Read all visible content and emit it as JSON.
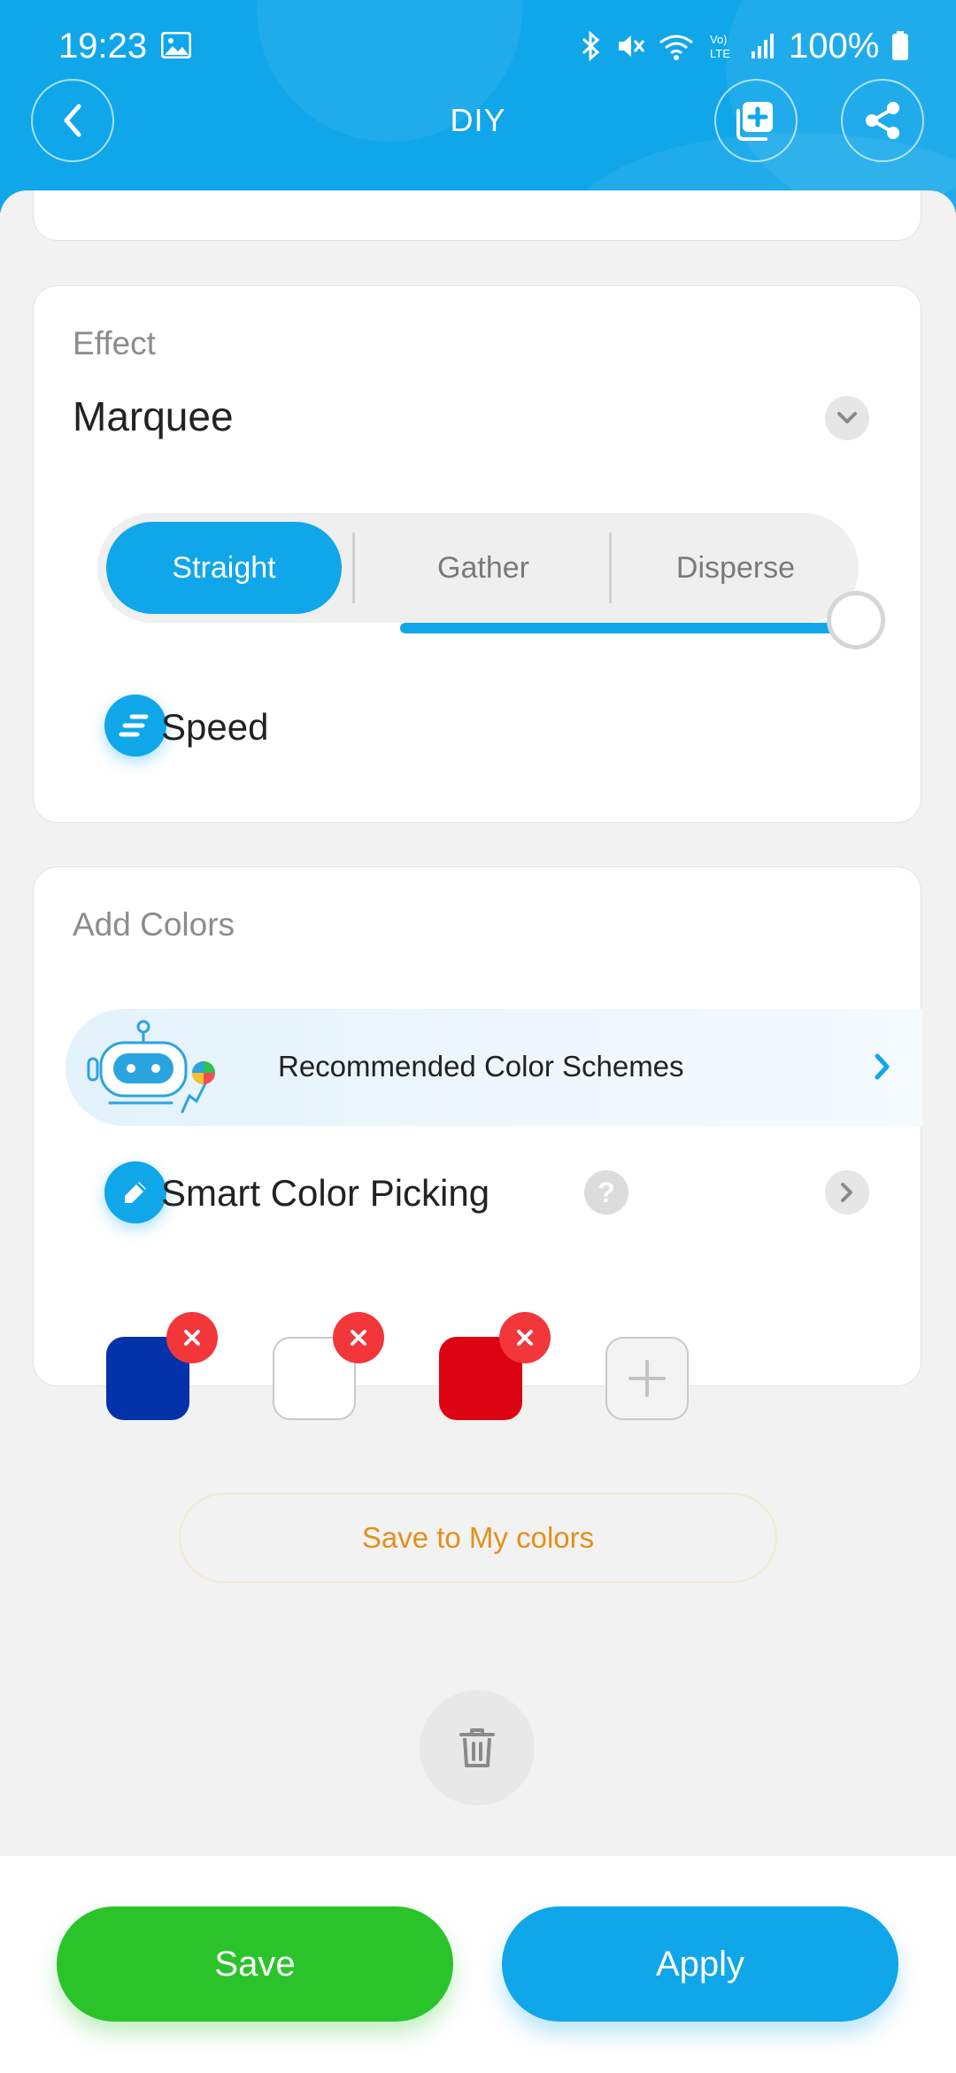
{
  "status_bar": {
    "time": "19:23",
    "battery": "100%"
  },
  "header": {
    "title": "DIY"
  },
  "effect_card": {
    "label": "Effect",
    "value": "Marquee",
    "segments": [
      {
        "label": "Straight",
        "selected": true
      },
      {
        "label": "Gather",
        "selected": false
      },
      {
        "label": "Disperse",
        "selected": false
      }
    ],
    "speed_label": "Speed",
    "speed_value_percent": 100
  },
  "colors_card": {
    "label": "Add Colors",
    "recommended_label": "Recommended Color Schemes",
    "smart_picking_label": "Smart Color Picking",
    "help_symbol": "?",
    "swatches": [
      "#0432a8",
      "#ffffff",
      "#dd0212"
    ],
    "save_colors_label": "Save to My colors"
  },
  "footer": {
    "save_label": "Save",
    "apply_label": "Apply"
  },
  "colors": {
    "accent": "#10a6ea",
    "save_green": "#2ac42a",
    "remove_red": "#f2363a",
    "save_colors_text": "#e3901a"
  }
}
